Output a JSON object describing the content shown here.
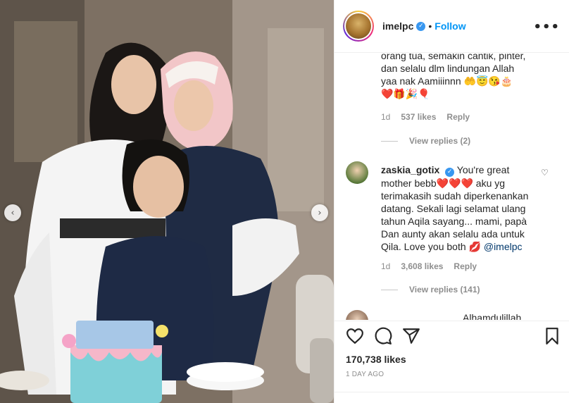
{
  "post": {
    "username": "imelpc",
    "follow_label": "Follow",
    "more_label": "•••",
    "dot": "•"
  },
  "photo": {
    "prev_icon": "chevron-left-icon",
    "next_icon": "chevron-right-icon"
  },
  "comments": {
    "top_comment": {
      "lines": [
        "orang tua, semakin cantik, pinter,",
        "dan selalu dlm lindungan Allah",
        "yaa nak Aamiiinnn 🤲😇😘🎂",
        "❤️🎁🎉🎈"
      ],
      "time": "1d",
      "likes": "537 likes",
      "reply": "Reply",
      "view_replies": "View replies (2)"
    },
    "second_comment": {
      "username": "zaskia_gotix",
      "text_lines": [
        "You're great",
        "mother bebb❤️❤️❤️ aku yg",
        "terimakasih sudah diperkenankan",
        "datang. Sekali lagi selamat ulang",
        "tahun Aqila sayang... mami, papà",
        "Dan aunty akan selalu ada untuk"
      ],
      "last_line": "Qila. Love you both 💋",
      "mention": "@imelpc",
      "time": "1d",
      "likes": "3,608 likes",
      "reply": "Reply",
      "view_replies": "View replies (141)"
    },
    "third_comment_partial": "Alhamdulillah"
  },
  "actions": {
    "likes_count": "170,738 likes",
    "time_ago": "1 DAY AGO"
  },
  "colors": {
    "accent": "#0095f6",
    "verified": "#3897f0",
    "muted": "#8e8e8e",
    "heart_red": "#ed4956"
  }
}
